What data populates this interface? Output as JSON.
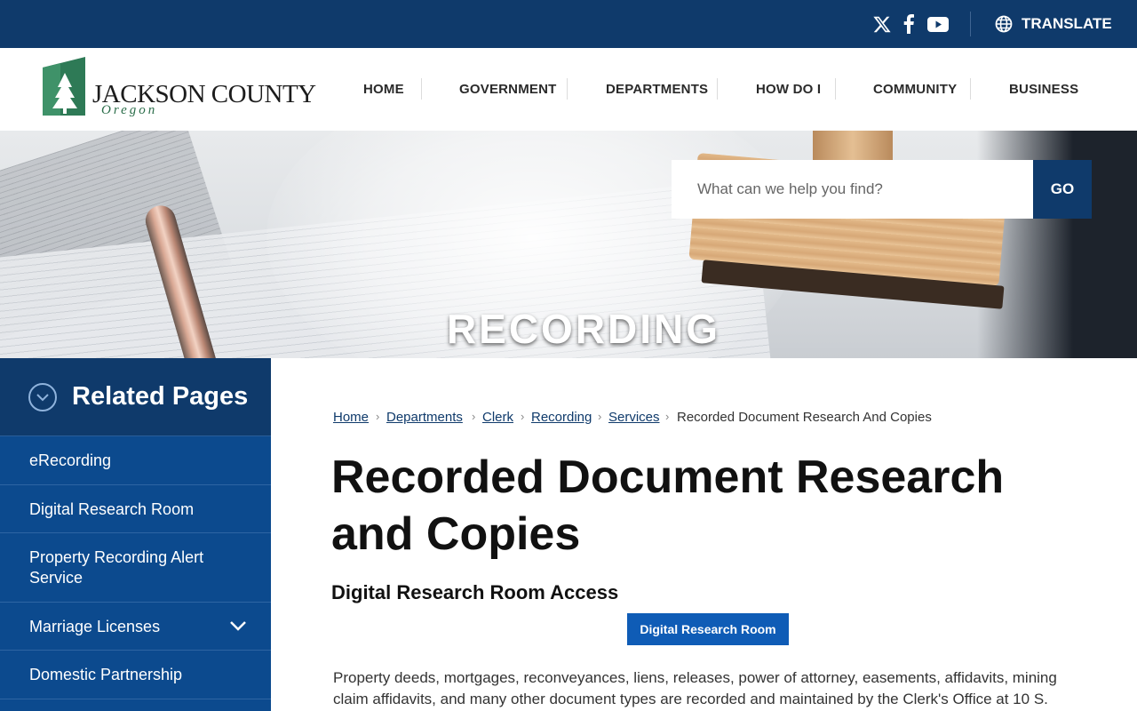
{
  "topbar": {
    "social": [
      "x-twitter-icon",
      "facebook-icon",
      "youtube-icon"
    ],
    "translate_label": "TRANSLATE",
    "bg_color": "#0f3a6b"
  },
  "header": {
    "logo_title": "JACKSON COUNTY",
    "logo_subtitle": "Oregon",
    "nav": [
      "HOME",
      "GOVERNMENT",
      "DEPARTMENTS",
      "HOW DO I",
      "COMMUNITY",
      "BUSINESS"
    ]
  },
  "hero": {
    "title": "RECORDING",
    "search_placeholder": "What can we help you find?",
    "search_button": "GO"
  },
  "sidebar": {
    "title": "Related Pages",
    "items": [
      {
        "label": "eRecording"
      },
      {
        "label": "Digital Research Room"
      },
      {
        "label": "Property Recording Alert Service"
      },
      {
        "label": "Marriage Licenses"
      },
      {
        "label": "Domestic Partnership"
      }
    ]
  },
  "breadcrumb": {
    "links": [
      "Home",
      "Departments",
      "Clerk",
      "Recording",
      "Services"
    ],
    "current": "Recorded Document Research And Copies"
  },
  "main": {
    "title": "Recorded Document Research and Copies",
    "section_title": "Digital Research Room Access",
    "cta_label": "Digital Research Room",
    "body": "Property deeds, mortgages, reconveyances, liens, releases, power of attorney, easements, affidavits, mining claim affidavits, and many other document types are recorded and maintained by the Clerk's Office at 10 S."
  }
}
